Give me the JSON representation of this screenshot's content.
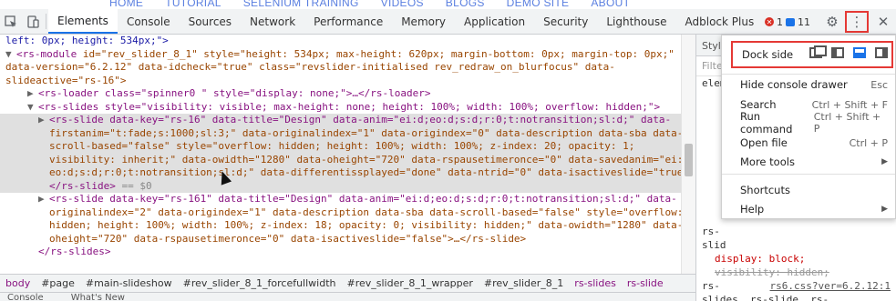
{
  "site_nav": [
    "HOME",
    "TUTORIAL",
    "SELENIUM TRAINING",
    "VIDEOS",
    "BLOGS",
    "DEMO SITE",
    "ABOUT"
  ],
  "toolbar": {
    "tabs": [
      "Elements",
      "Console",
      "Sources",
      "Network",
      "Performance",
      "Memory",
      "Application",
      "Security",
      "Lighthouse",
      "Adblock Plus"
    ],
    "active_tab": "Elements",
    "error_count": "1",
    "message_count": "11",
    "accent_color": "#1a73e8",
    "highlight_color": "#e53935"
  },
  "elements": {
    "lines": {
      "l1": "left: 0px; height: 534px;\">",
      "l2_tag": "<rs-module",
      "l2_rest": " id=\"rev_slider_8_1\" style=\"height: 534px; max-height: 620px; margin-bottom: 0px; margin-top: 0px;\"",
      "l3": "data-version=\"6.2.12\" data-idcheck=\"true\" class=\"revslider-initialised rev_redraw_on_blurfocus\" data-",
      "l4": "slideactive=\"rs-16\">",
      "l5": "<rs-loader class=\"spinner0 \" style=\"display: none;\">…</rs-loader>",
      "l6": "<rs-slides style=\"visibility: visible; max-height: none; height: 100%; width: 100%; overflow: hidden;\">",
      "l7": "<rs-slide data-key=\"rs-16\" data-title=\"Design\" data-anim=\"ei:d;eo:d;s:d;r:0;t:notransition;sl:d;\" data-",
      "l8": "firstanim=\"t:fade;s:1000;sl:3;\" data-originalindex=\"1\" data-origindex=\"0\" data-description data-sba data-",
      "l9": "scroll-based=\"false\" style=\"overflow: hidden; height: 100%; width: 100%; z-index: 20; opacity: 1;",
      "l10": "visibility: inherit;\" data-owidth=\"1280\" data-oheight=\"720\" data-rspausetimeronce=\"0\" data-savedanim=\"ei:d;",
      "l11": "eo:d;s:d;r:0;t:notransition;sl:d;\" data-differentissplayed=\"done\" data-ntrid=\"0\" data-isactiveslide=\"true\">…",
      "l12": "</rs-slide>",
      "l12_ref": " == $0",
      "l13": "<rs-slide data-key=\"rs-161\" data-title=\"Design\" data-anim=\"ei:d;eo:d;s:d;r:0;t:notransition;sl:d;\" data-",
      "l14": "originalindex=\"2\" data-origindex=\"1\" data-description data-sba data-scroll-based=\"false\" style=\"overflow:",
      "l15": "hidden; height: 100%; width: 100%; z-index: 18; opacity: 0; visibility: hidden;\" data-owidth=\"1280\" data-",
      "l16": "oheight=\"720\" data-rspausetimeronce=\"0\" data-isactiveslide=\"false\">…</rs-slide>",
      "l17": "</rs-slides>"
    }
  },
  "breadcrumbs": [
    "body",
    "#page",
    "#main-slideshow",
    "#rev_slider_8_1_forcefullwidth",
    "#rev_slider_8_1_wrapper",
    "#rev_slider_8_1",
    "rs-slides",
    "rs-slide"
  ],
  "drawer_tabs": [
    "Console",
    "What's New"
  ],
  "styles_pane": {
    "tab": "Styl",
    "filter": "Filte",
    "lines": [
      "elem",
      "rs-",
      "slid",
      "display: block;",
      "visibility: hidden;",
      "rs-",
      "slides, rs-slide, rs-",
      "rs6.css?ver=6.2.12:1"
    ]
  },
  "menu": {
    "dock_label": "Dock side",
    "items": [
      {
        "label": "Hide console drawer",
        "shortcut": "Esc"
      },
      {
        "label": "Search",
        "shortcut": "Ctrl + Shift + F"
      },
      {
        "label": "Run command",
        "shortcut": "Ctrl + Shift + P"
      },
      {
        "label": "Open file",
        "shortcut": "Ctrl + P"
      },
      {
        "label": "More tools",
        "shortcut": ""
      },
      {
        "label": "Shortcuts",
        "shortcut": ""
      },
      {
        "label": "Help",
        "shortcut": ""
      }
    ]
  }
}
